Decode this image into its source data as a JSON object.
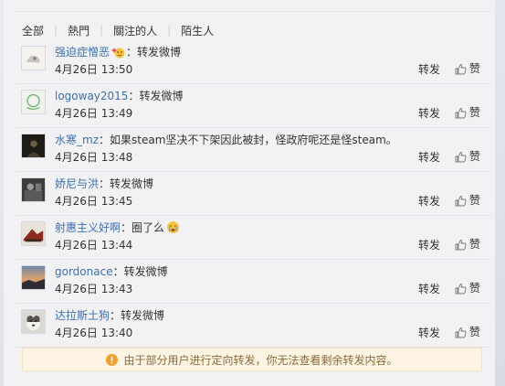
{
  "filters": [
    "全部",
    "熱門",
    "關注的人",
    "陌生人"
  ],
  "comments": [
    {
      "user": "强迫症憎恶",
      "content": "：转发微博",
      "time": "4月26日 13:50",
      "repost": "转发",
      "like": "赞",
      "emoji": "sparkle-face"
    },
    {
      "user": "logoway2015",
      "content": "：转发微博",
      "time": "4月26日 13:49",
      "repost": "转发",
      "like": "赞"
    },
    {
      "user": "水寒_mz",
      "content": "：如果steam坚决不下架因此被封，怪政府呢还是怪steam。",
      "time": "4月26日 13:48",
      "repost": "转发",
      "like": "赞"
    },
    {
      "user": "娇尼与洪",
      "content": "：转发微博",
      "time": "4月26日 13:45",
      "repost": "转发",
      "like": "赞"
    },
    {
      "user": "射惠主义好啊",
      "content": "：圈了么",
      "time": "4月26日 13:44",
      "repost": "转发",
      "like": "赞",
      "emoji": "crying-face"
    },
    {
      "user": "gordonace",
      "content": "：转发微博",
      "time": "4月26日 13:43",
      "repost": "转发",
      "like": "赞"
    },
    {
      "user": "达拉斯土狗",
      "content": "：转发微博",
      "time": "4月26日 13:40",
      "repost": "转发",
      "like": "赞"
    }
  ],
  "notice": "由于部分用户进行定向转发，你无法查看剩余转发内容。",
  "colors": {
    "username": "#3a6fb0",
    "notice_bg": "#fdf4e4",
    "notice_icon": "#f0a030"
  }
}
